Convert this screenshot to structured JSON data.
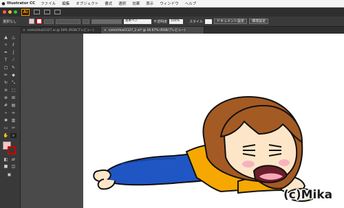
{
  "menubar": {
    "apple": "",
    "app_name": "Illustrator CC",
    "items": [
      "ファイル",
      "編集",
      "オブジェクト",
      "書式",
      "選択",
      "効果",
      "表示",
      "ウィンドウ",
      "ヘルプ"
    ]
  },
  "appbar": {
    "logo": "Ai",
    "traffic_colors": [
      "#fe5f57",
      "#febc2e",
      "#28c840"
    ]
  },
  "control": {
    "selection": "選択なし",
    "stroke_style": "基本ペン",
    "opacity_label": "不透明度",
    "opacity_value": "100%",
    "style_label": "スタイル",
    "doc_setup": "ドキュメント設定",
    "prefs": "環境設定"
  },
  "tabs": [
    {
      "label": "comicillust1127.ai @ 18% (RGB/プレビュー)",
      "close": "×"
    },
    {
      "label": "comicillust1127_2.ai* @ 16.67% (RGB/プレビュー)",
      "close": "×"
    }
  ],
  "tools": {
    "fill_color": "#f7c5c5",
    "stroke_color": "#d10000",
    "icons": [
      "selection-icon",
      "direct-selection-icon",
      "magic-wand-icon",
      "lasso-icon",
      "pen-icon",
      "curvature-icon",
      "type-icon",
      "line-icon",
      "rectangle-icon",
      "paintbrush-icon",
      "pencil-icon",
      "eraser-icon",
      "rotate-icon",
      "scale-icon",
      "width-icon",
      "free-transform-icon",
      "shape-builder-icon",
      "perspective-icon",
      "mesh-icon",
      "gradient-icon",
      "eyedropper-icon",
      "blend-icon",
      "symbol-sprayer-icon",
      "column-graph-icon",
      "artboard-icon",
      "slice-icon",
      "hand-icon",
      "zoom-icon"
    ]
  },
  "credit": "(c)Mika"
}
